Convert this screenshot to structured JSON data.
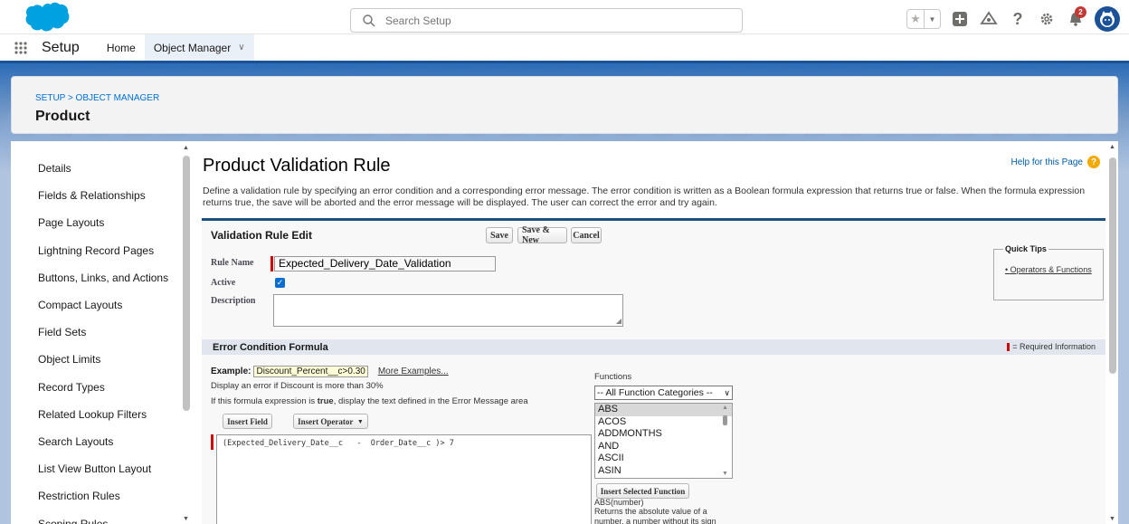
{
  "header": {
    "search_placeholder": "Search Setup",
    "notification_count": "2"
  },
  "nav": {
    "app_name": "Setup",
    "tabs": [
      {
        "label": "Home"
      },
      {
        "label": "Object Manager"
      }
    ]
  },
  "title_card": {
    "breadcrumb": "SETUP > OBJECT MANAGER",
    "title": "Product"
  },
  "sidebar": {
    "items": [
      {
        "label": "Details"
      },
      {
        "label": "Fields & Relationships"
      },
      {
        "label": "Page Layouts"
      },
      {
        "label": "Lightning Record Pages"
      },
      {
        "label": "Buttons, Links, and Actions"
      },
      {
        "label": "Compact Layouts"
      },
      {
        "label": "Field Sets"
      },
      {
        "label": "Object Limits"
      },
      {
        "label": "Record Types"
      },
      {
        "label": "Related Lookup Filters"
      },
      {
        "label": "Search Layouts"
      },
      {
        "label": "List View Button Layout"
      },
      {
        "label": "Restriction Rules"
      },
      {
        "label": "Scoping Rules"
      }
    ]
  },
  "main": {
    "help_link": "Help for this Page",
    "title": "Product Validation Rule",
    "description": "Define a validation rule by specifying an error condition and a corresponding error message. The error condition is written as a Boolean formula expression that returns true or false. When the formula expression returns true, the save will be aborted and the error message will be displayed. The user can correct the error and try again.",
    "block_title": "Validation Rule Edit",
    "buttons": {
      "save": "Save",
      "save_new": "Save & New",
      "cancel": "Cancel"
    },
    "fields": {
      "rule_name_label": "Rule Name",
      "rule_name_value": "Expected_Delivery_Date_Validation",
      "active_label": "Active",
      "description_label": "Description"
    },
    "quick_tips": {
      "title": "Quick Tips",
      "link": "Operators & Functions"
    },
    "error_condition": {
      "title": "Error Condition Formula",
      "required_legend": "= Required Information",
      "example_label": "Example:",
      "example_code": "Discount_Percent__c>0.30",
      "more_examples": "More Examples...",
      "example_desc": "Display an error if Discount is more than 30%",
      "instruction_pre": "If this formula expression is ",
      "instruction_bold": "true",
      "instruction_post": ", display the text defined in the Error Message area",
      "insert_field": "Insert Field",
      "insert_operator": "Insert Operator",
      "formula": "(Expected_Delivery_Date__c   -  Order_Date__c )> 7"
    },
    "functions": {
      "label": "Functions",
      "category": "-- All Function Categories --",
      "list": [
        "ABS",
        "ACOS",
        "ADDMONTHS",
        "AND",
        "ASCII",
        "ASIN"
      ],
      "selected": "ABS",
      "insert_button": "Insert Selected Function",
      "signature": "ABS(number)",
      "description": "Returns the absolute value of a number, a number without its sign"
    }
  }
}
